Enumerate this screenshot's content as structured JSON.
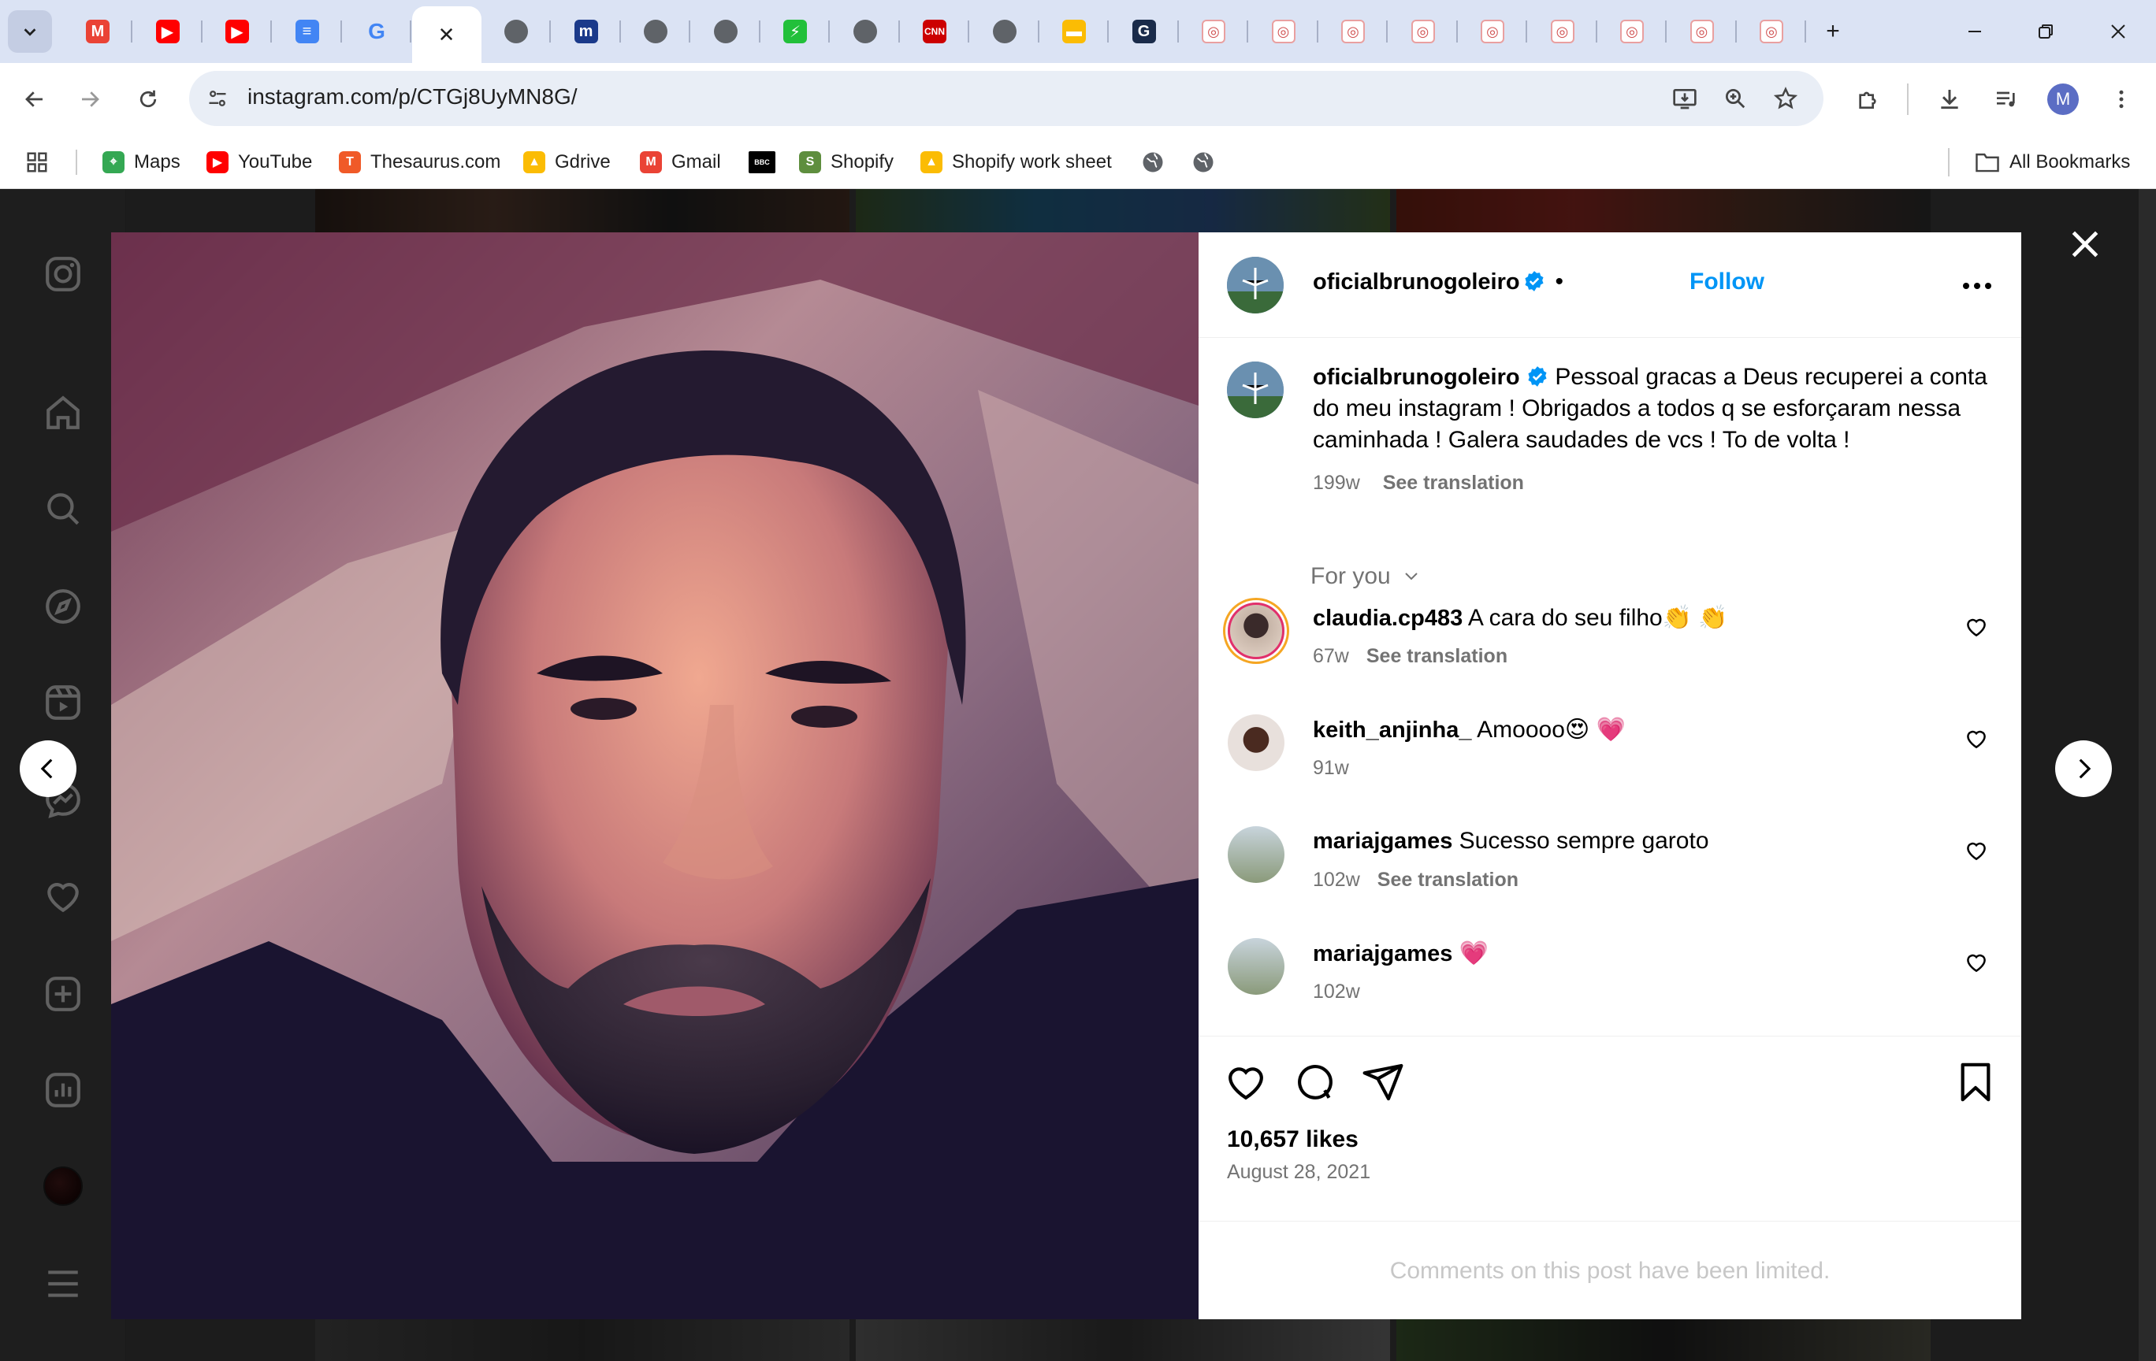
{
  "browser": {
    "tabs": [
      {
        "icon": "gmail-icon",
        "active": false
      },
      {
        "icon": "youtube-icon",
        "active": false
      },
      {
        "icon": "youtube-icon",
        "active": false
      },
      {
        "icon": "google-docs-icon",
        "active": false
      },
      {
        "icon": "google-icon",
        "active": false
      },
      {
        "icon": "close-icon",
        "active": true
      },
      {
        "icon": "globe-icon",
        "active": false
      },
      {
        "icon": "merriam-webster-icon",
        "active": false
      },
      {
        "icon": "globe-icon",
        "active": false
      },
      {
        "icon": "globe-icon",
        "active": false
      },
      {
        "icon": "lightning-icon",
        "active": false
      },
      {
        "icon": "globe-icon",
        "active": false
      },
      {
        "icon": "cnn-icon",
        "active": false
      },
      {
        "icon": "globe-icon",
        "active": false
      },
      {
        "icon": "slides-icon",
        "active": false
      },
      {
        "icon": "g-icon",
        "active": false
      },
      {
        "icon": "instagram-icon",
        "active": false
      },
      {
        "icon": "instagram-icon",
        "active": false
      },
      {
        "icon": "instagram-icon",
        "active": false
      },
      {
        "icon": "instagram-icon",
        "active": false
      },
      {
        "icon": "instagram-icon",
        "active": false
      },
      {
        "icon": "instagram-icon",
        "active": false
      },
      {
        "icon": "instagram-icon",
        "active": false
      },
      {
        "icon": "instagram-icon",
        "active": false
      },
      {
        "icon": "instagram-icon",
        "active": false
      }
    ],
    "url": "instagram.com/p/CTGj8UyMN8G/",
    "profile_initial": "M",
    "bookmarks": [
      {
        "label": "Maps",
        "icon": "maps-icon"
      },
      {
        "label": "YouTube",
        "icon": "youtube-icon"
      },
      {
        "label": "Thesaurus.com",
        "icon": "thesaurus-icon"
      },
      {
        "label": "Gdrive",
        "icon": "drive-icon"
      },
      {
        "label": "Gmail",
        "icon": "gmail-icon"
      },
      {
        "label": "",
        "icon": "bbc-icon"
      },
      {
        "label": "Shopify",
        "icon": "shopify-icon"
      },
      {
        "label": "Shopify work sheet",
        "icon": "drive-icon"
      }
    ],
    "all_bookmarks": "All Bookmarks"
  },
  "post": {
    "username": "oficialbrunogoleiro",
    "dot": "•",
    "follow_label": "Follow",
    "caption": "Pessoal gracas a Deus recuperei a conta do meu instagram ! Obrigados a todos q se esforçaram nessa caminhada ! Galera saudades de vcs ! To de volta !",
    "caption_age": "199w",
    "see_translation": "See translation",
    "for_you": "For you",
    "comments": [
      {
        "user": "claudia.cp483",
        "text": "A cara do seu filho👏 👏",
        "age": "67w",
        "translation": "See translation"
      },
      {
        "user": "keith_anjinha_",
        "text": "Amoooo😍 💗",
        "age": "91w",
        "translation": ""
      },
      {
        "user": "mariajgames",
        "text": "Sucesso sempre garoto",
        "age": "102w",
        "translation": "See translation"
      },
      {
        "user": "mariajgames",
        "text": "💗",
        "age": "102w",
        "translation": ""
      }
    ],
    "likes": "10,657 likes",
    "date": "August 28, 2021",
    "comments_limited": "Comments on this post have been limited."
  },
  "colors": {
    "accent": "#0095f6",
    "verified": "#0095f6",
    "overlay": "rgba(0,0,0,0.62)"
  }
}
